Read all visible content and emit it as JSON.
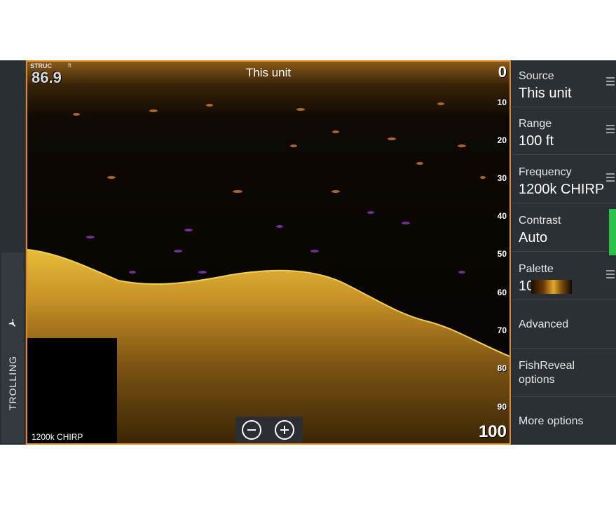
{
  "side_tab": {
    "label": "TROLLING",
    "icon": "propeller-icon"
  },
  "sonar": {
    "mode_label": "STRUC",
    "unit_label": "ft",
    "depth_reading": "86.9",
    "source_title": "This unit",
    "depth_scale": [
      "0",
      "10",
      "20",
      "30",
      "40",
      "50",
      "60",
      "70",
      "80",
      "90",
      "100"
    ],
    "frequency_label": "1200k CHIRP",
    "zoom_out_icon": "minus-circle-icon",
    "zoom_in_icon": "plus-circle-icon"
  },
  "menu": {
    "items": [
      {
        "title": "Source",
        "value": "This unit"
      },
      {
        "title": "Range",
        "value": "100 ft"
      },
      {
        "title": "Frequency",
        "value": "1200k CHIRP"
      },
      {
        "title": "Contrast",
        "value": "Auto"
      },
      {
        "title": "Palette",
        "value": "10"
      },
      {
        "title": "Advanced"
      },
      {
        "title": "FishReveal",
        "title2": "options"
      },
      {
        "title": "More options"
      }
    ]
  },
  "colors": {
    "frame_accent": "#e08a1e",
    "contrast_indicator": "#2ec04c",
    "bottom_return": "#d9a830"
  }
}
